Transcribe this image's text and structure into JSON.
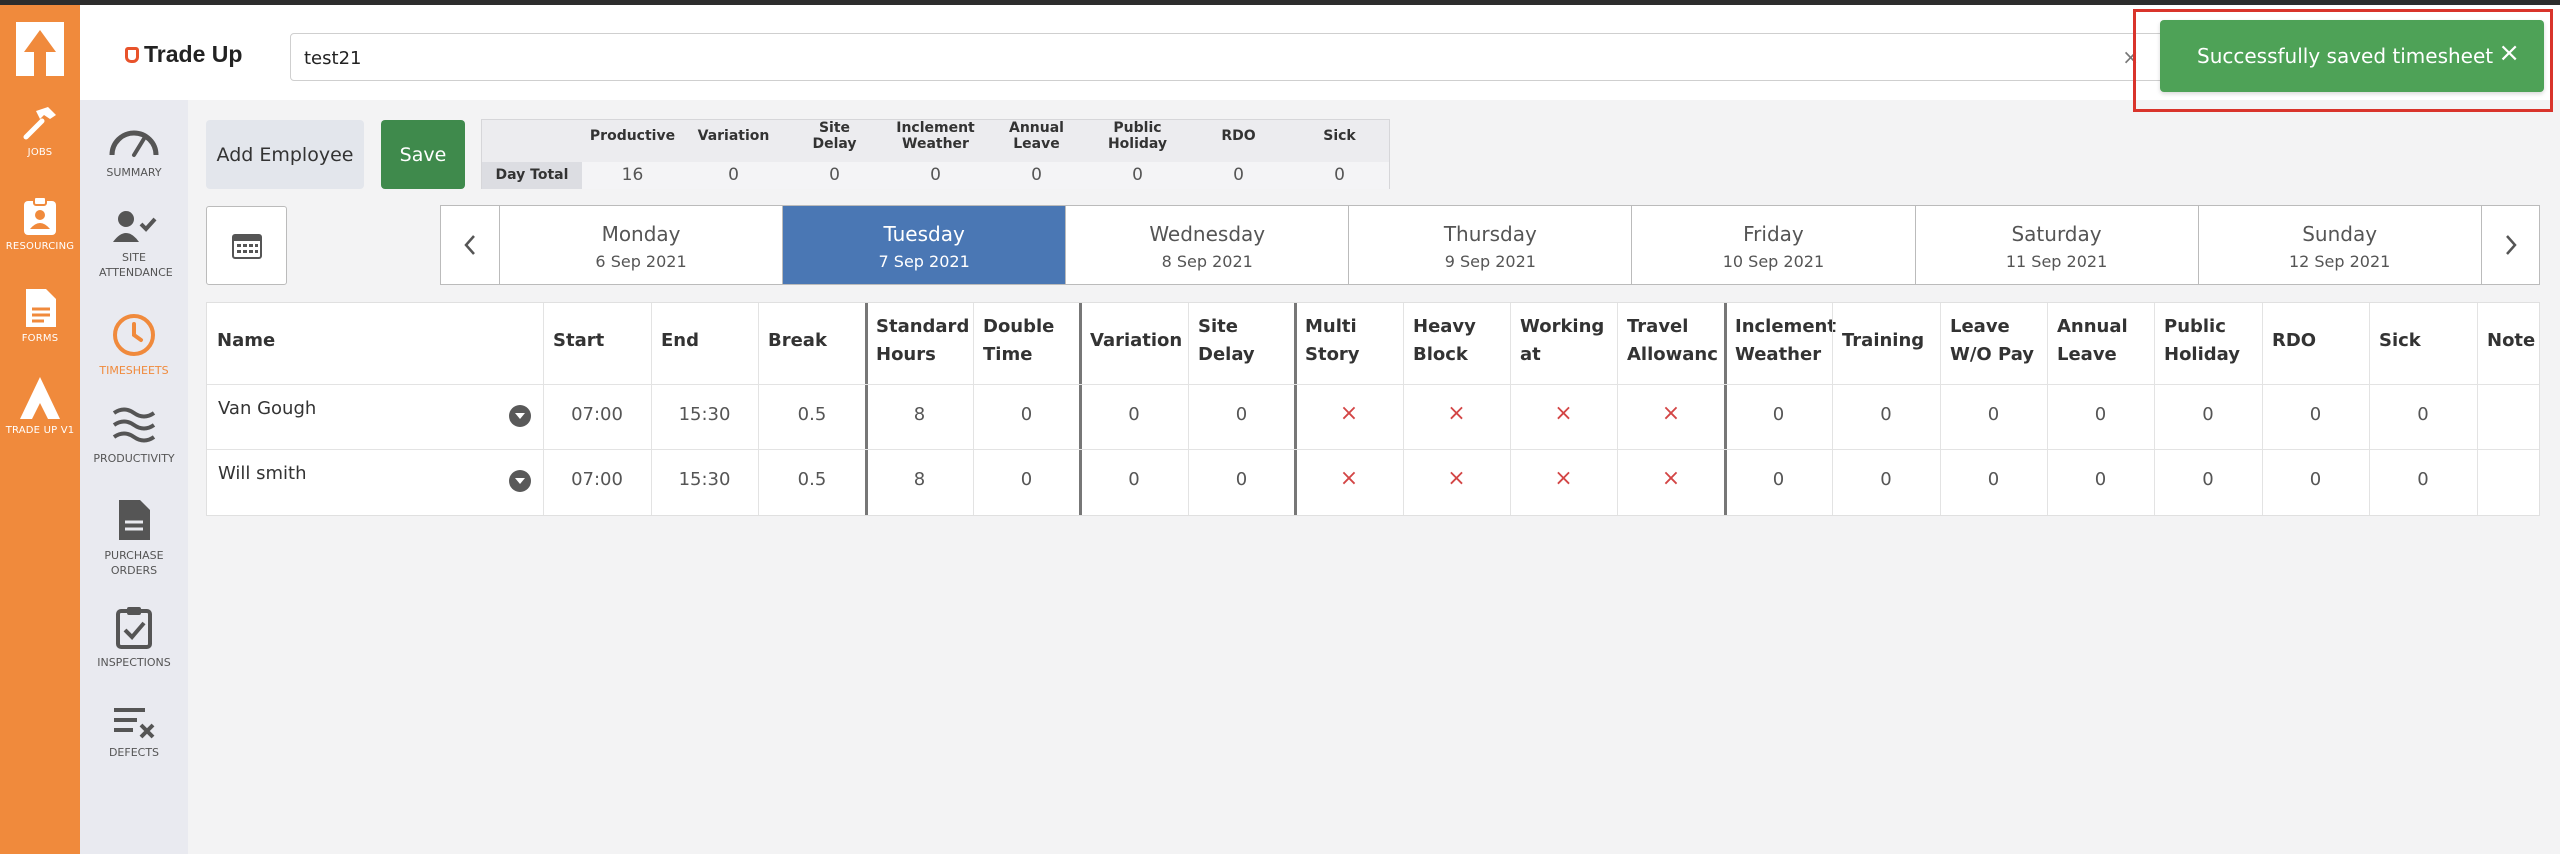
{
  "app": {
    "brand": "Trade Up"
  },
  "rail": {
    "items": [
      {
        "label": "JOBS",
        "icon": "hammer-icon"
      },
      {
        "label": "RESOURCING",
        "icon": "clipboard-user-icon"
      },
      {
        "label": "FORMS",
        "icon": "document-icon"
      },
      {
        "label": "TRADE UP V1",
        "icon": "trade-up-logo-icon"
      }
    ]
  },
  "sidebar": {
    "items": [
      {
        "label": "SUMMARY",
        "icon": "gauge-icon"
      },
      {
        "label": "SITE ATTENDANCE",
        "icon": "user-check-icon"
      },
      {
        "label": "TIMESHEETS",
        "icon": "clock-icon",
        "active": true
      },
      {
        "label": "PRODUCTIVITY",
        "icon": "waves-icon"
      },
      {
        "label": "PURCHASE ORDERS",
        "icon": "file-icon"
      },
      {
        "label": "INSPECTIONS",
        "icon": "clipboard-check-icon"
      },
      {
        "label": "DEFECTS",
        "icon": "list-x-icon"
      }
    ]
  },
  "search": {
    "value": "test21",
    "clear": "×"
  },
  "toast": {
    "message": "Successfully saved timesheet",
    "close": "×"
  },
  "actions": {
    "add_employee": "Add Employee",
    "save": "Save"
  },
  "totals": {
    "row_label": "Day Total",
    "headers": [
      "Productive",
      "Variation",
      "Site Delay",
      "Inclement Weather",
      "Annual Leave",
      "Public Holiday",
      "RDO",
      "Sick"
    ],
    "values": [
      "16",
      "0",
      "0",
      "0",
      "0",
      "0",
      "0",
      "0"
    ]
  },
  "week": {
    "days": [
      {
        "name": "Monday",
        "date": "6 Sep 2021"
      },
      {
        "name": "Tuesday",
        "date": "7 Sep 2021",
        "active": true
      },
      {
        "name": "Wednesday",
        "date": "8 Sep 2021"
      },
      {
        "name": "Thursday",
        "date": "9 Sep 2021"
      },
      {
        "name": "Friday",
        "date": "10 Sep 2021"
      },
      {
        "name": "Saturday",
        "date": "11 Sep 2021"
      },
      {
        "name": "Sunday",
        "date": "12 Sep 2021"
      }
    ]
  },
  "grid": {
    "columns": [
      "Name",
      "Start",
      "End",
      "Break",
      "Standard Hours",
      "Double Time",
      "Variation",
      "Site Delay",
      "Multi Story",
      "Heavy Block",
      "Working at",
      "Travel Allowanc",
      "Inclement Weather",
      "Training",
      "Leave W/O Pay",
      "Annual Leave",
      "Public Holiday",
      "RDO",
      "Sick",
      "Note"
    ],
    "rows": [
      {
        "name": "Van Gough",
        "cells": [
          "07:00",
          "15:30",
          "0.5",
          "8",
          "0",
          "0",
          "0",
          "×",
          "×",
          "×",
          "×",
          "0",
          "0",
          "0",
          "0",
          "0",
          "0",
          "0",
          ""
        ]
      },
      {
        "name": "Will smith",
        "cells": [
          "07:00",
          "15:30",
          "0.5",
          "8",
          "0",
          "0",
          "0",
          "×",
          "×",
          "×",
          "×",
          "0",
          "0",
          "0",
          "0",
          "0",
          "0",
          "0",
          ""
        ]
      }
    ]
  },
  "colors": {
    "brand_orange": "#f08a3c",
    "save_green": "#3f8a4c",
    "toast_green": "#4ea257",
    "active_day_blue": "#4a77b4",
    "cross_red": "#d34545"
  }
}
